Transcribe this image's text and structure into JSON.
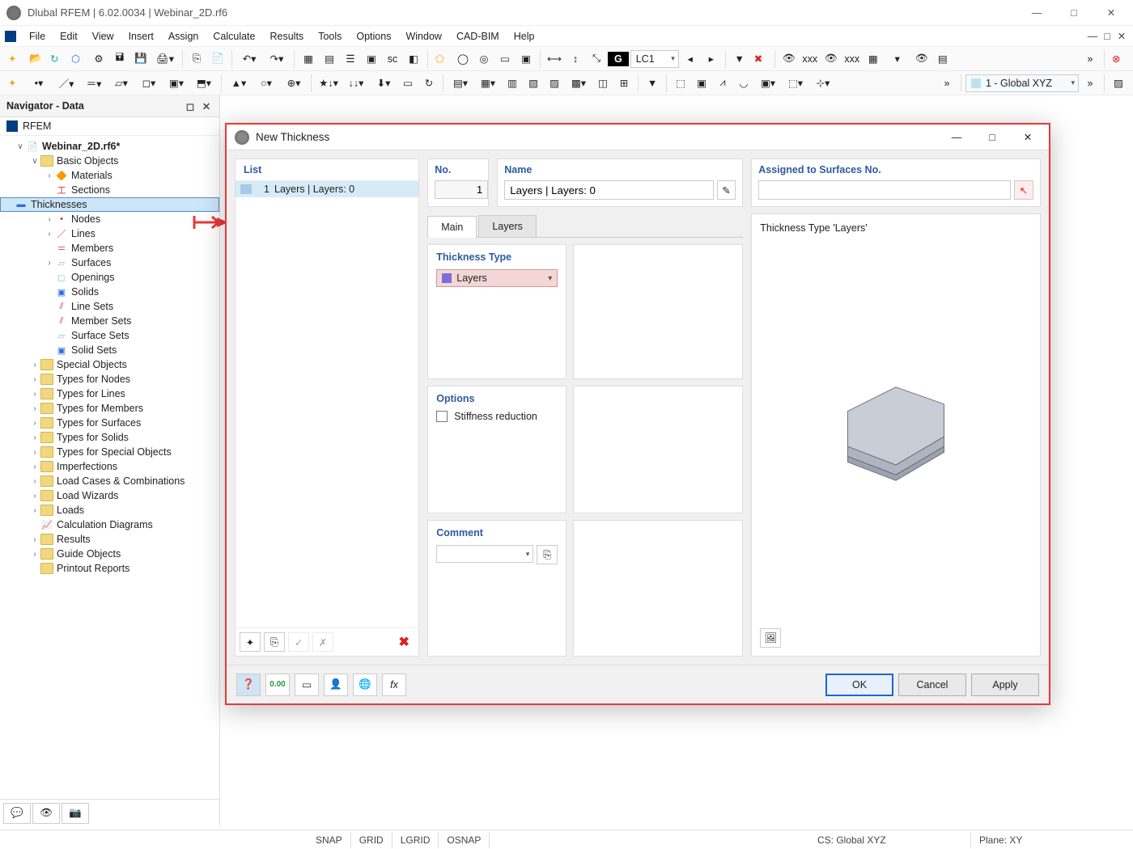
{
  "window": {
    "title": "Dlubal RFEM | 6.02.0034 | Webinar_2D.rf6",
    "min": "—",
    "max": "□",
    "close": "✕"
  },
  "menu": [
    "File",
    "Edit",
    "View",
    "Insert",
    "Assign",
    "Calculate",
    "Results",
    "Tools",
    "Options",
    "Window",
    "CAD-BIM",
    "Help"
  ],
  "toolbar1": {
    "lc_label": "G",
    "lc_value": "LC1",
    "cs": "1 - Global XYZ"
  },
  "navigator": {
    "title": "Navigator - Data",
    "root": "RFEM",
    "project": "Webinar_2D.rf6*",
    "basic": "Basic Objects",
    "items": [
      "Materials",
      "Sections",
      "Thicknesses",
      "Nodes",
      "Lines",
      "Members",
      "Surfaces",
      "Openings",
      "Solids",
      "Line Sets",
      "Member Sets",
      "Surface Sets",
      "Solid Sets"
    ],
    "folders": [
      "Special Objects",
      "Types for Nodes",
      "Types for Lines",
      "Types for Members",
      "Types for Surfaces",
      "Types for Solids",
      "Types for Special Objects",
      "Imperfections",
      "Load Cases & Combinations",
      "Load Wizards",
      "Loads",
      "Calculation Diagrams",
      "Results",
      "Guide Objects",
      "Printout Reports"
    ]
  },
  "dialog": {
    "title": "New Thickness",
    "list_header": "List",
    "list_num": "1",
    "list_text": "Layers | Layers: 0",
    "no_label": "No.",
    "no_value": "1",
    "name_label": "Name",
    "name_value": "Layers | Layers: 0",
    "assigned_label": "Assigned to Surfaces No.",
    "assigned_value": "",
    "tabs": {
      "main": "Main",
      "layers": "Layers"
    },
    "thickness_type_label": "Thickness Type",
    "thickness_type_value": "Layers",
    "options_label": "Options",
    "stiffness_label": "Stiffness reduction",
    "comment_label": "Comment",
    "comment_value": "",
    "preview_text": "Thickness Type  'Layers'",
    "ok": "OK",
    "cancel": "Cancel",
    "apply": "Apply"
  },
  "status": {
    "snap": "SNAP",
    "grid": "GRID",
    "lgrid": "LGRID",
    "osnap": "OSNAP",
    "cs": "CS: Global XYZ",
    "plane": "Plane: XY"
  }
}
